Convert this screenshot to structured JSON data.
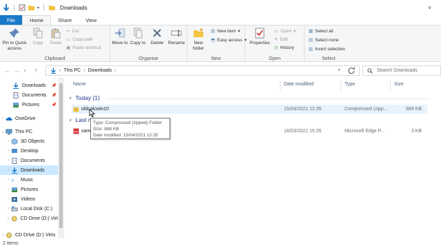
{
  "window": {
    "title": "Downloads"
  },
  "ribbon_tabs": [
    "File",
    "Home",
    "Share",
    "View"
  ],
  "ribbon": {
    "clipboard": {
      "label": "Clipboard",
      "pin": "Pin to Quick access",
      "copy": "Copy",
      "paste": "Paste",
      "cut": "Cut",
      "copy_path": "Copy path",
      "paste_shortcut": "Paste shortcut"
    },
    "organise": {
      "label": "Organise",
      "move_to": "Move to",
      "copy_to": "Copy to",
      "delete": "Delete",
      "rename": "Rename"
    },
    "new": {
      "label": "New",
      "new_folder": "New folder",
      "new_item": "New item",
      "easy_access": "Easy access"
    },
    "open": {
      "label": "Open",
      "properties": "Properties",
      "open": "Open",
      "edit": "Edit",
      "history": "History"
    },
    "select": {
      "label": "Select",
      "select_all": "Select all",
      "select_none": "Select none",
      "invert": "Invert selection"
    }
  },
  "address": {
    "crumbs": [
      "This PC",
      "Downloads"
    ],
    "search_placeholder": "Search Downloads"
  },
  "nav": [
    {
      "label": "Downloads",
      "pinned": true
    },
    {
      "label": "Documents",
      "pinned": true
    },
    {
      "label": "Pictures",
      "pinned": true
    },
    {
      "label": "OneDrive"
    },
    {
      "label": "This PC"
    },
    {
      "label": "3D Objects"
    },
    {
      "label": "Desktop"
    },
    {
      "label": "Documents"
    },
    {
      "label": "Downloads",
      "selected": true
    },
    {
      "label": "Music"
    },
    {
      "label": "Pictures"
    },
    {
      "label": "Videos"
    },
    {
      "label": "Local Disk (C:)"
    },
    {
      "label": "CD Drive (D:) Virt"
    },
    {
      "label": "CD Drive (D:) Virtu"
    }
  ],
  "columns": {
    "name": "Name",
    "date": "Date modified",
    "type": "Type",
    "size": "Size"
  },
  "groups": [
    {
      "label": "Today (1)",
      "files": [
        {
          "name": "oldcalcwin10",
          "date": "15/04/2021 12:35",
          "type": "Compressed (zipp...",
          "size": "889 KB"
        }
      ]
    },
    {
      "label": "Last m",
      "files": [
        {
          "name": "sam",
          "date": "16/03/2021 15:35",
          "type": "Microsoft Edge P...",
          "size": "3 KB"
        }
      ]
    }
  ],
  "tooltip": {
    "type": "Type: Compressed (zipped) Folder",
    "size": "Size: 888 KB",
    "date": "Date modified: 15/04/2021 12:35"
  },
  "status": {
    "items": "2 items"
  },
  "colors": {
    "accent": "#1979ca",
    "folder": "#f3c542",
    "selection": "#cce8ff"
  }
}
